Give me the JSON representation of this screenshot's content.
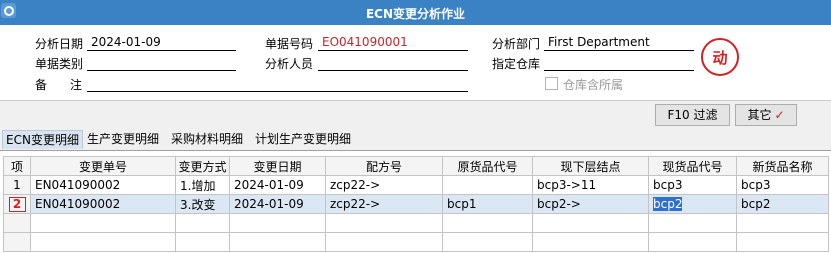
{
  "window": {
    "title": "ECN变更分析作业"
  },
  "form": {
    "analysis_date_label": "分析日期",
    "analysis_date_value": "2024-01-09",
    "doc_no_label": "单据号码",
    "doc_no_value": "EO041090001",
    "dept_label": "分析部门",
    "dept_value": "First Department",
    "doc_type_label": "单据类别",
    "doc_type_value": "",
    "analyst_label": "分析人员",
    "analyst_value": "",
    "warehouse_label": "指定仓库",
    "warehouse_value": "",
    "remark_label_1": "备",
    "remark_label_2": "注",
    "remark_value": "",
    "include_sub_warehouse_label": "仓库含所属",
    "stamp_text": "动"
  },
  "toolbar": {
    "filter_label": "F10 过滤",
    "other_label": "其它",
    "check_glyph": "✓"
  },
  "tabs": [
    "ECN变更明细",
    "生产变更明细",
    "采购材料明细",
    "计划生产变更明细"
  ],
  "grid": {
    "headers": [
      "项",
      "变更单号",
      "变更方式",
      "变更日期",
      "配方号",
      "原货品代号",
      "现下层结点",
      "现货品代号",
      "新货品名称"
    ],
    "rows": [
      [
        "1",
        "EN041090002",
        "1.增加",
        "2024-01-09",
        "zcp22->",
        "",
        "bcp3->11",
        "bcp3",
        "bcp3"
      ],
      [
        "2",
        "EN041090002",
        "3.改变",
        "2024-01-09",
        "zcp22->",
        "bcp1",
        "bcp2->",
        "bcp2",
        "bcp2"
      ]
    ]
  },
  "colors": {
    "title_bar": "#3a82c4",
    "selected_row": "#dce7f5",
    "accent_red": "#d42020"
  }
}
